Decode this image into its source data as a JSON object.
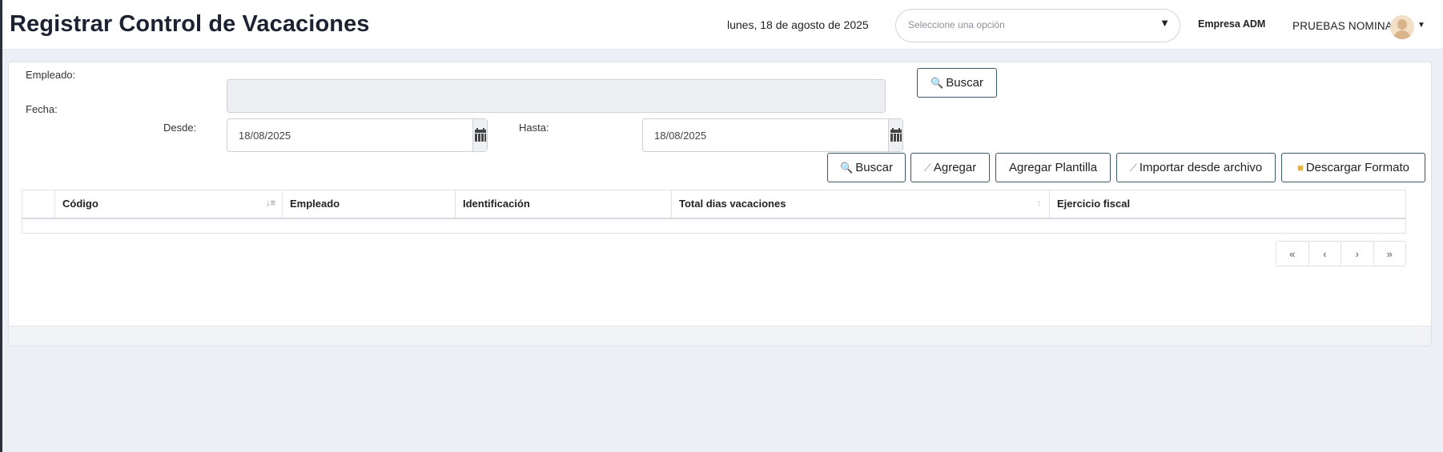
{
  "header": {
    "title": "Registrar Control de Vacaciones",
    "date": "lunes, 18 de agosto de 2025",
    "select_placeholder": "Seleccione una opción",
    "company": "Empresa ADM",
    "user": "PRUEBAS NOMINA"
  },
  "form": {
    "empleado_label": "Empleado:",
    "fecha_label": "Fecha:",
    "desde_label": "Desde:",
    "hasta_label": "Hasta:",
    "desde_value": "18/08/2025",
    "hasta_value": "18/08/2025",
    "buscar_empleado_label": "Buscar"
  },
  "toolbar": {
    "buscar": "Buscar",
    "agregar": "Agregar",
    "agregar_plantilla": "Agregar Plantilla",
    "importar": "Importar desde archivo",
    "descargar": "Descargar Formato"
  },
  "table": {
    "columns": [
      "",
      "Código",
      "Empleado",
      "Identificación",
      "Total dias vacaciones",
      "Ejercicio fiscal"
    ],
    "rows": []
  },
  "pagination": {
    "first": "«",
    "prev": "‹",
    "next": "›",
    "last": "»"
  },
  "icons": {
    "search": "search-icon",
    "pencil": "pencil-icon",
    "folder": "folder-icon",
    "calendar": "calendar-icon"
  }
}
